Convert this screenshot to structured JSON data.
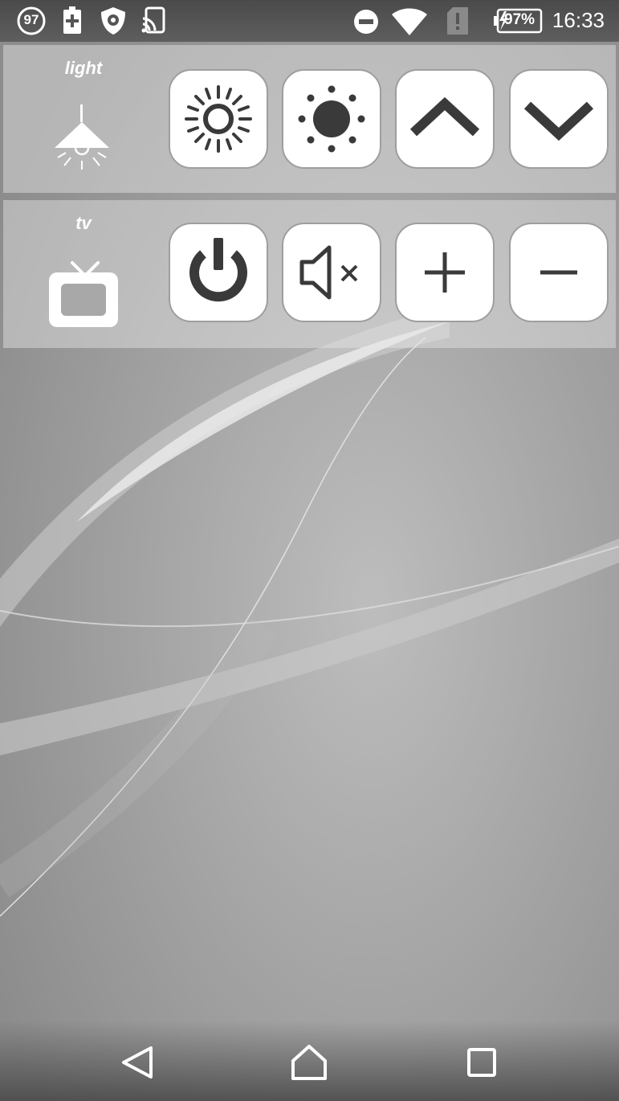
{
  "status_bar": {
    "notification_count": "97",
    "battery_percent": "97%",
    "time": "16:33",
    "left_icons": [
      "count-badge-icon",
      "battery-saver-icon",
      "antivirus-shield-icon",
      "cast-icon"
    ],
    "right_icons": [
      "do-not-disturb-icon",
      "wifi-icon",
      "sim-alert-icon",
      "battery-icon"
    ]
  },
  "widgets": {
    "light": {
      "title": "light",
      "icon": "ceiling-lamp-icon",
      "buttons": [
        "brightness-low-icon",
        "brightness-high-icon",
        "chevron-up-icon",
        "chevron-down-icon"
      ]
    },
    "tv": {
      "title": "tv",
      "icon": "tv-icon",
      "buttons": [
        "power-icon",
        "mute-icon",
        "plus-icon",
        "minus-icon"
      ]
    }
  },
  "nav_bar": {
    "buttons": [
      "back-icon",
      "home-icon",
      "recents-icon"
    ]
  },
  "colors": {
    "button_icon": "#3a3a3a",
    "widget_bg": "#d8d8d8",
    "wallpaper": "#9a9a9a"
  }
}
